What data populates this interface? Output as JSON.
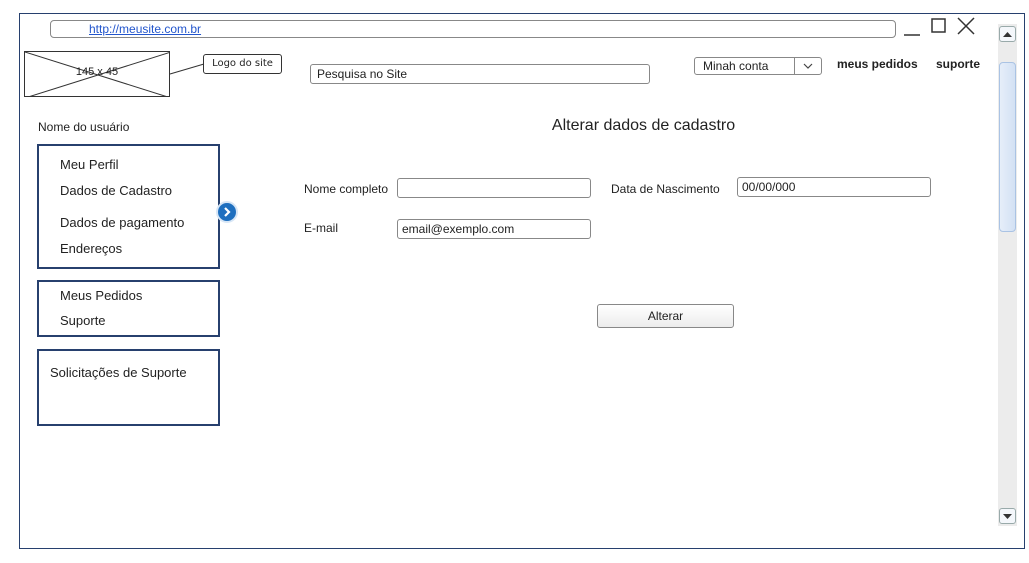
{
  "browser": {
    "url": "http://meusite.com.br"
  },
  "header": {
    "logo_placeholder": "145 x 45",
    "logo_callout": "Logo do site",
    "search_placeholder": "Pesquisa no Site",
    "account_select": "Minah conta",
    "link_orders": "meus pedidos",
    "link_support": "suporte"
  },
  "sidebar": {
    "user_name": "Nome do usuário",
    "group1": [
      "Meu Perfil",
      "Dados de Cadastro",
      "Dados de pagamento",
      "Endereços"
    ],
    "group2": [
      "Meus Pedidos",
      "Suporte"
    ],
    "group3": [
      "Solicitações de Suporte"
    ]
  },
  "form": {
    "title": "Alterar dados de cadastro",
    "name_label": "Nome completo",
    "name_value": "",
    "birth_label": "Data de Nascimento",
    "birth_value": "00/00/000",
    "email_label": "E-mail",
    "email_value": "email@exemplo.com",
    "submit": "Alterar"
  },
  "icons": {
    "minimize": "minimize-icon",
    "maximize": "maximize-icon",
    "close": "close-icon",
    "expand": "chevron-right-circle-icon"
  }
}
